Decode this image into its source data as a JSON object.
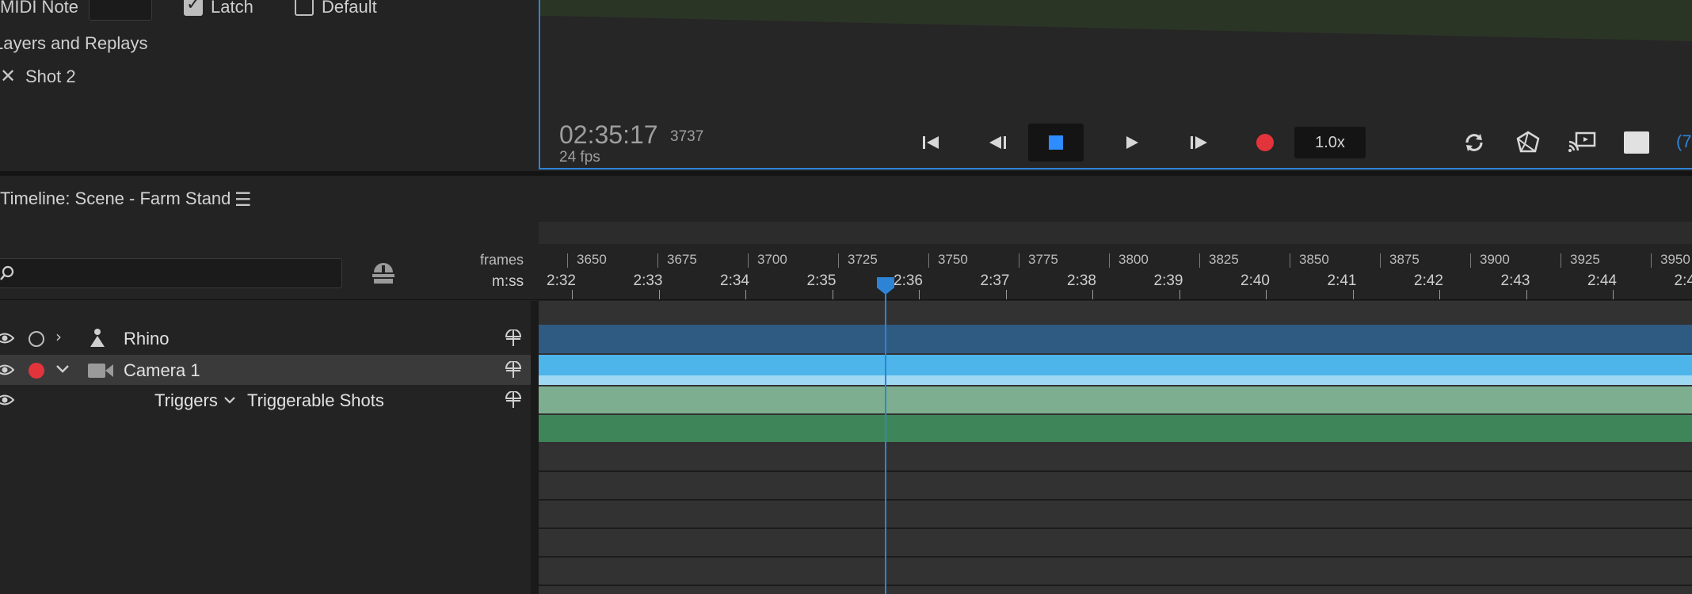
{
  "top_panel": {
    "midi_label": "MIDI Note",
    "latch_label": "Latch",
    "latch_checked": true,
    "default_label": "Default",
    "default_checked": false,
    "layers_replays_label": "Layers and Replays",
    "shot_item": "Shot 2"
  },
  "viewer": {
    "timecode": "02:35:17",
    "frame": "3737",
    "fps": "24 fps",
    "speed": "1.0x",
    "overflow_label": "(7"
  },
  "timeline": {
    "title": "Timeline: Scene - Farm Stand",
    "frames_label": "frames",
    "mss_label": "m:ss",
    "frame_ticks": [
      "3650",
      "3675",
      "3700",
      "3725",
      "3750",
      "3775",
      "3800",
      "3825",
      "3850",
      "3875",
      "3900",
      "3925",
      "3950"
    ],
    "time_ticks": [
      "2:32",
      "2:33",
      "2:34",
      "2:35",
      "2:36",
      "2:37",
      "2:38",
      "2:39",
      "2:40",
      "2:41",
      "2:42",
      "2:43",
      "2:44",
      "2:4"
    ]
  },
  "tracks": [
    {
      "name": "Rhino",
      "color": "#2f5a82"
    },
    {
      "name": "Camera 1",
      "color": "#4db5ea"
    },
    {
      "name": "Triggers",
      "dropdown": "Triggerable Shots",
      "color": "#7eae90"
    }
  ],
  "colors": {
    "accent": "#2d84d6",
    "record": "#e3343b",
    "green_track": "#3f855a"
  }
}
